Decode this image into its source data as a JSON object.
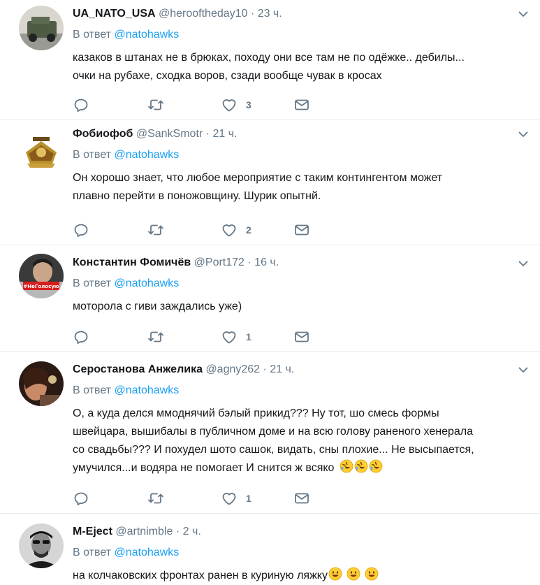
{
  "tweets": [
    {
      "name": "UA_NATO_USA",
      "handle": "@herooftheday10",
      "separator": "·",
      "time": "23 ч.",
      "reply_prefix": "В ответ",
      "reply_to": "@natohawks",
      "lines": [
        "казаков в штанах не в брюках, походу они все там не по одёжке.. дебилы...",
        "очки на рубахе, сходка воров, сзади вообще чувак в кросах"
      ],
      "likes": "3"
    },
    {
      "name": "Фобиофоб",
      "handle": "@SankSmotr",
      "separator": "·",
      "time": "21 ч.",
      "reply_prefix": "В ответ",
      "reply_to": "@natohawks",
      "lines": [
        "Он хорошо знает, что любое мероприятие с таким контингентом может",
        "плавно перейти в поножовщину. Шурик опытнй."
      ],
      "likes": "2"
    },
    {
      "name": "Константин Фомичёв",
      "handle": "@Port172",
      "separator": "·",
      "time": "16 ч.",
      "reply_prefix": "В ответ",
      "reply_to": "@natohawks",
      "avatar_badge": "#НеГолосую",
      "lines": [
        "моторола с гиви заждались уже)"
      ],
      "likes": "1"
    },
    {
      "name": "Серостанова Анжелика",
      "handle": "@agny262",
      "separator": "·",
      "time": "21 ч.",
      "reply_prefix": "В ответ",
      "reply_to": "@natohawks",
      "lines": [
        "О, а куда делся ммоднячий бэлый прикид??? Ну тот, шо смесь формы",
        "швейцара, вышибалы в публичном доме и на всю голову раненого хенерала",
        "со свадьбы??? И похудел шото сашок, видать, сны плохие... Не высыпается,",
        "умучился...и водяра не помогает И снится ж всяко"
      ],
      "likes": "1"
    },
    {
      "name": "M-Eject",
      "handle": "@artnimble",
      "separator": "·",
      "time": "2 ч.",
      "reply_prefix": "В ответ",
      "reply_to": "@natohawks",
      "lines": [
        "на колчаковских фронтах ранен в куриную ляжку"
      ],
      "likes": ""
    }
  ],
  "icons": {
    "reply": "reply-icon",
    "retweet": "retweet-icon",
    "like": "like-icon",
    "dm": "envelope-icon",
    "caret": "chevron-down-icon",
    "rofl": "rofl-emoji",
    "smile": "smile-emoji"
  },
  "colors": {
    "accent": "#1da1f2",
    "secondary_text": "#657786",
    "divider": "#e6ecf0",
    "emoji": "#ffcc33"
  }
}
